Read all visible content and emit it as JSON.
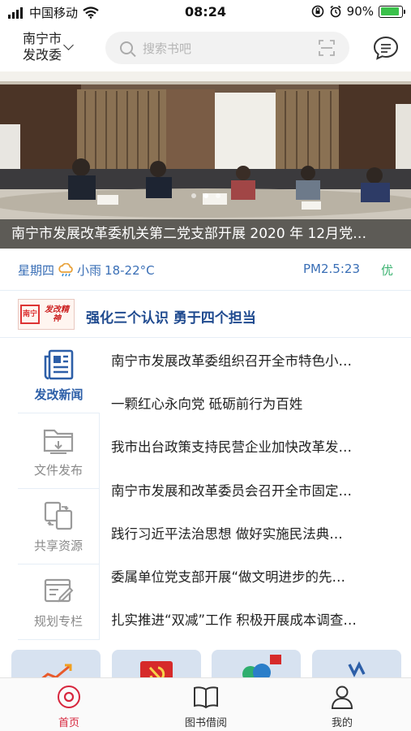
{
  "status_bar": {
    "carrier": "中国移动",
    "time": "08:24",
    "battery_text": "90%",
    "battery_level": 0.9
  },
  "header": {
    "city_line1": "南宁市",
    "city_line2": "发改委",
    "search_placeholder": "搜索书吧",
    "icons": [
      "chevron-down-icon",
      "search-icon",
      "scan-icon",
      "message-icon"
    ]
  },
  "banner": {
    "caption": "南宁市发展改革委机关第二党支部开展 2020 年 12月党…",
    "active_dot": 1,
    "dot_count": 3
  },
  "weather": {
    "day": "星期四",
    "condition": "小雨",
    "temp": "18-22°C",
    "pm25": "PM2.5:23",
    "aqi": "优"
  },
  "slogan": {
    "seal_left": "南宁",
    "seal_right": "发改精神",
    "text": "强化三个认识 勇于四个担当"
  },
  "nav": {
    "items": [
      {
        "label": "发改新闻",
        "active": true
      },
      {
        "label": "文件发布",
        "active": false
      },
      {
        "label": "共享资源",
        "active": false
      },
      {
        "label": "规划专栏",
        "active": false
      }
    ]
  },
  "news": {
    "items": [
      "南宁市发展改革委组织召开全市特色小…",
      "一颗红心永向党 砥砺前行为百姓",
      "我市出台政策支持民营企业加快改革发…",
      "南宁市发展和改革委员会召开全市固定…",
      "践行习近平法治思想 做好实施民法典…",
      "委属单位党支部开展“做文明进步的先…",
      "扎实推进“双减”工作 积极开展成本调查…"
    ]
  },
  "tabbar": {
    "tabs": [
      {
        "label": "首页",
        "active": true
      },
      {
        "label": "图书借阅",
        "active": false
      },
      {
        "label": "我的",
        "active": false
      }
    ]
  },
  "colors": {
    "primary_blue": "#2d5fa8",
    "active_red": "#d7263d",
    "aqi_green": "#3cb371"
  }
}
